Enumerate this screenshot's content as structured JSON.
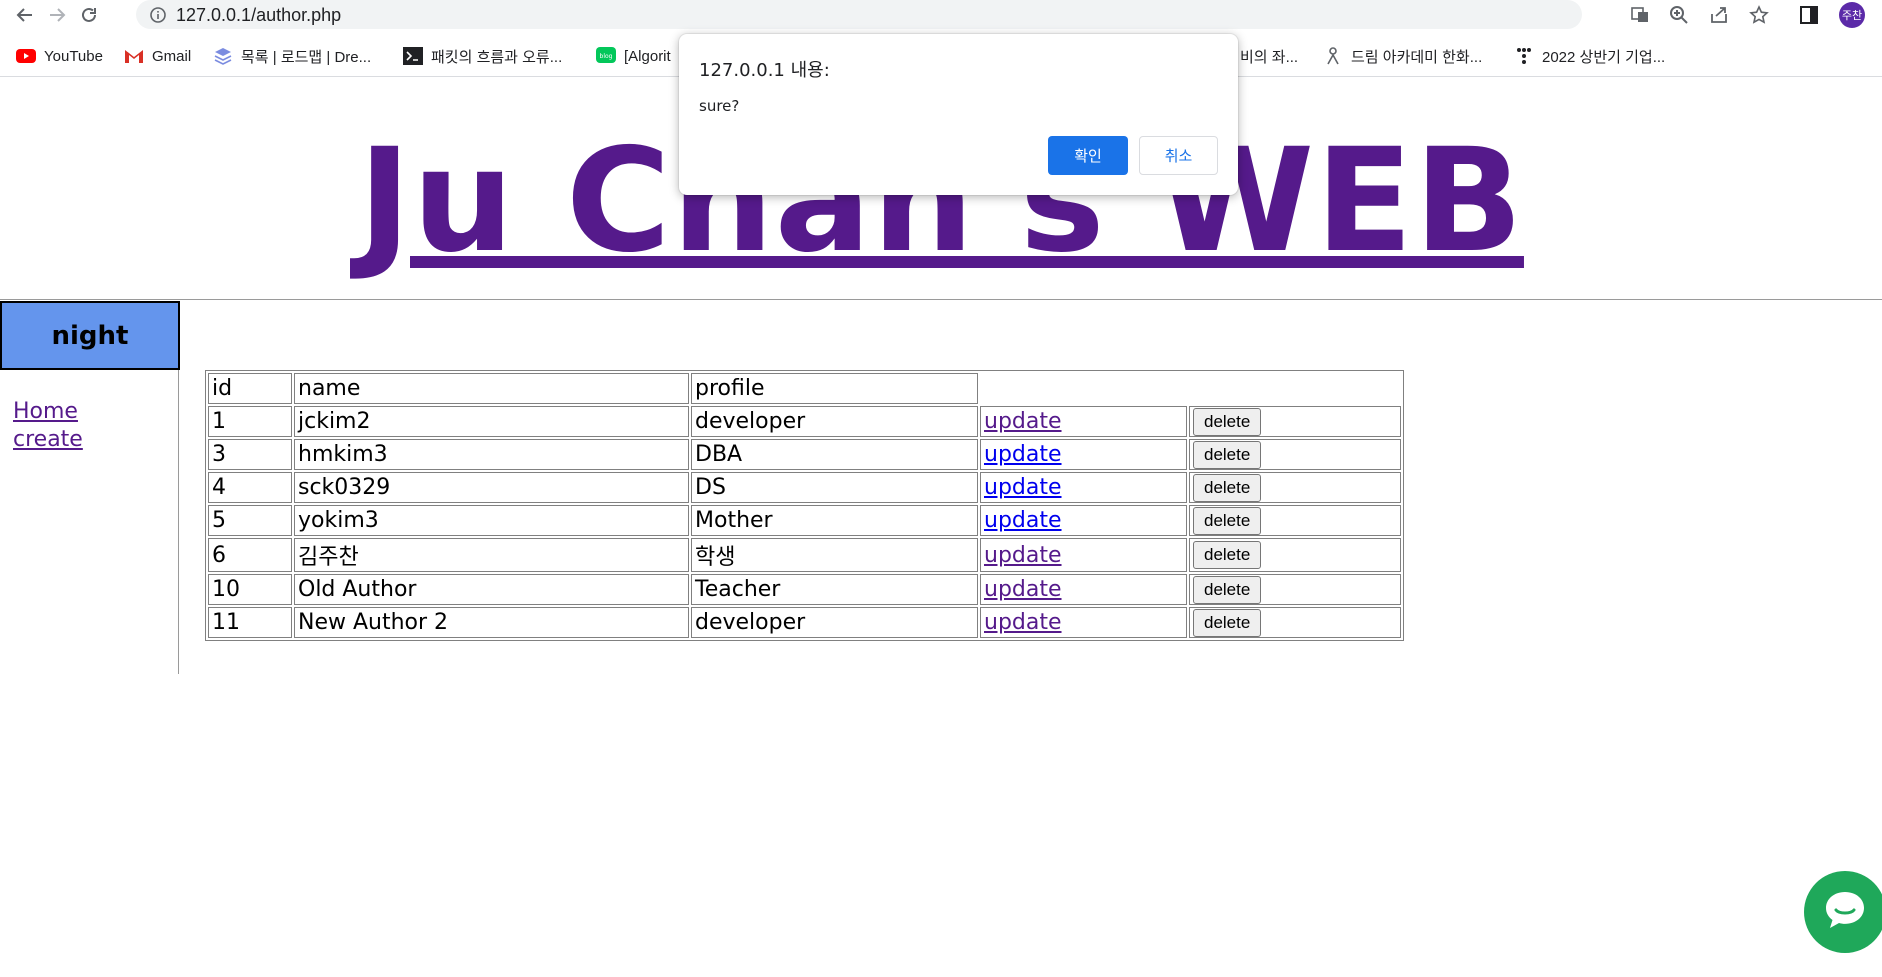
{
  "browser": {
    "url": "127.0.0.1/author.php",
    "avatar_text": "주찬",
    "icons": [
      "back-icon",
      "forward-icon",
      "reload-icon",
      "site-info-icon",
      "translate-icon",
      "zoom-icon",
      "share-icon",
      "star-icon",
      "side-panel-icon"
    ]
  },
  "bookmarks": [
    {
      "label": "YouTube",
      "icon": "youtube-icon"
    },
    {
      "label": "Gmail",
      "icon": "gmail-icon"
    },
    {
      "label": "목록 | 로드맵 | Dre...",
      "icon": "roadmap-icon"
    },
    {
      "label": "패킷의 흐름과 오류...",
      "icon": "terminal-icon"
    },
    {
      "label": "[Algorit",
      "icon": "blog-icon"
    },
    {
      "label": "비의 좌...",
      "icon": ""
    },
    {
      "label": "드림 아카데미 한화...",
      "icon": "person-icon"
    },
    {
      "label": "2022 상반기 기업...",
      "icon": "dots-icon"
    }
  ],
  "page": {
    "site_title": "Ju Chan's WEB",
    "night_button": "night",
    "nav": {
      "home": "Home",
      "create": "create"
    }
  },
  "table": {
    "headers": [
      "id",
      "name",
      "profile"
    ],
    "update_label": "update",
    "delete_label": "delete",
    "rows": [
      {
        "id": "1",
        "name": "jckim2",
        "profile": "developer"
      },
      {
        "id": "3",
        "name": "hmkim3",
        "profile": "DBA"
      },
      {
        "id": "4",
        "name": "sck0329",
        "profile": "DS"
      },
      {
        "id": "5",
        "name": "yokim3",
        "profile": "Mother"
      },
      {
        "id": "6",
        "name": "김주찬",
        "profile": "학생"
      },
      {
        "id": "10",
        "name": "Old Author",
        "profile": "Teacher"
      },
      {
        "id": "11",
        "name": "New Author 2",
        "profile": "developer"
      }
    ]
  },
  "dialog": {
    "title": "127.0.0.1 내용:",
    "message": "sure?",
    "ok_label": "확인",
    "cancel_label": "취소"
  },
  "colors": {
    "title_purple": "#551a8b",
    "night_button_bg": "#6495ed",
    "dialog_ok_bg": "#1a73e8",
    "chat_green": "#1fa85a"
  }
}
